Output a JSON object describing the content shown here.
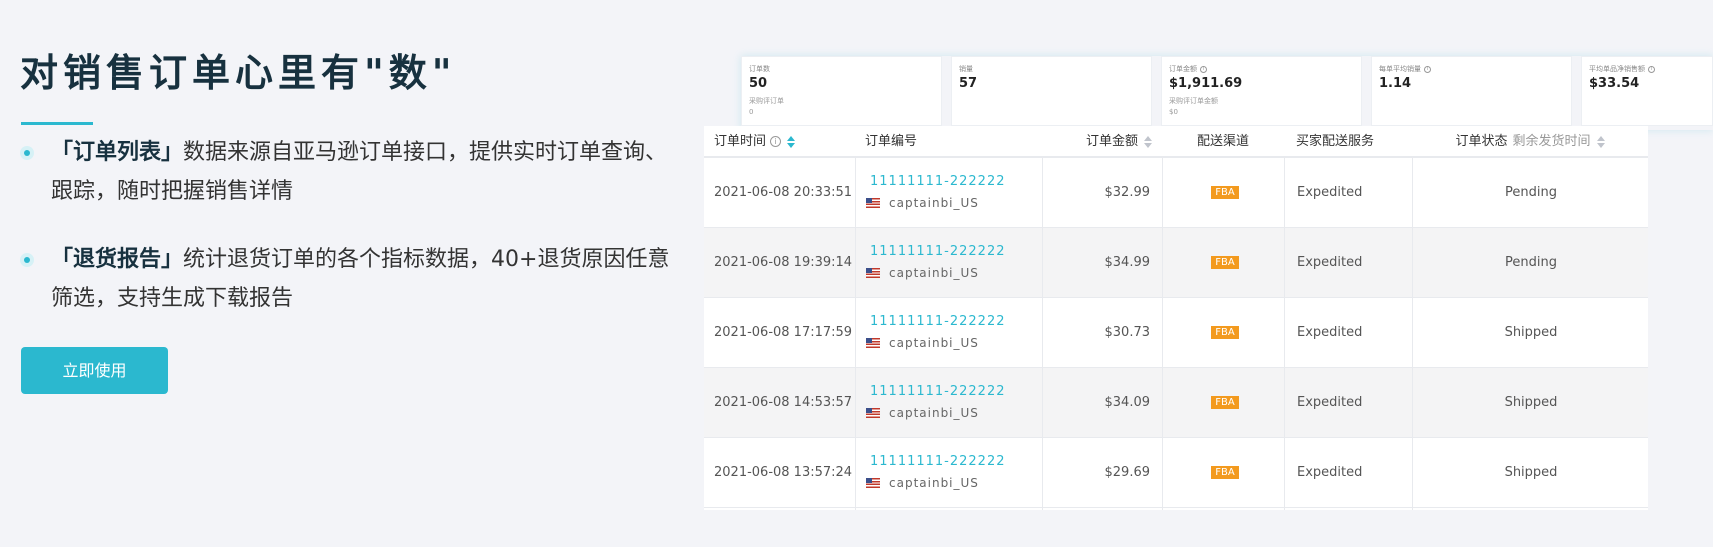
{
  "hero": {
    "title": "对销售订单心里有\"数\"",
    "features": [
      {
        "highlight": "「订单列表」",
        "text": "数据来源自亚马逊订单接口，提供实时订单查询、跟踪，随时把握销售详情"
      },
      {
        "highlight": "「退货报告」",
        "text": "统计退货订单的各个指标数据，40+退货原因任意筛选，支持生成下载报告"
      }
    ],
    "cta_label": "立即使用"
  },
  "stats": [
    {
      "label": "订单数",
      "value": "50",
      "sub_label": "采购评订单",
      "sub_value": "0"
    },
    {
      "label": "销量",
      "value": "57"
    },
    {
      "label": "订单金额",
      "value": "$1,911.69",
      "sub_label": "采购评订单金额",
      "sub_value": "$0"
    },
    {
      "label": "每单平均销量",
      "value": "1.14"
    },
    {
      "label": "平均单品净销售额",
      "value": "$33.54"
    }
  ],
  "table": {
    "headers": {
      "order_time": "订单时间",
      "order_id": "订单编号",
      "amount": "订单金额",
      "channel": "配送渠道",
      "buyer_service": "买家配送服务",
      "status": "订单状态",
      "status_extra": "剩余发货时间"
    },
    "rows": [
      {
        "time": "2021-06-08 20:33:51",
        "order_id": "11111111-222222",
        "seller": "captainbi_US",
        "amount": "$32.99",
        "channel": "FBA",
        "service": "Expedited",
        "status": "Pending"
      },
      {
        "time": "2021-06-08 19:39:14",
        "order_id": "11111111-222222",
        "seller": "captainbi_US",
        "amount": "$34.99",
        "channel": "FBA",
        "service": "Expedited",
        "status": "Pending"
      },
      {
        "time": "2021-06-08 17:17:59",
        "order_id": "11111111-222222",
        "seller": "captainbi_US",
        "amount": "$30.73",
        "channel": "FBA",
        "service": "Expedited",
        "status": "Shipped"
      },
      {
        "time": "2021-06-08 14:53:57",
        "order_id": "11111111-222222",
        "seller": "captainbi_US",
        "amount": "$34.09",
        "channel": "FBA",
        "service": "Expedited",
        "status": "Shipped"
      },
      {
        "time": "2021-06-08 13:57:24",
        "order_id": "11111111-222222",
        "seller": "captainbi_US",
        "amount": "$29.69",
        "channel": "FBA",
        "service": "Expedited",
        "status": "Shipped"
      }
    ]
  },
  "colors": {
    "accent": "#2bb8cf",
    "title": "#17313f",
    "fba_badge": "#f39a1e",
    "background": "#f3f4f8"
  }
}
